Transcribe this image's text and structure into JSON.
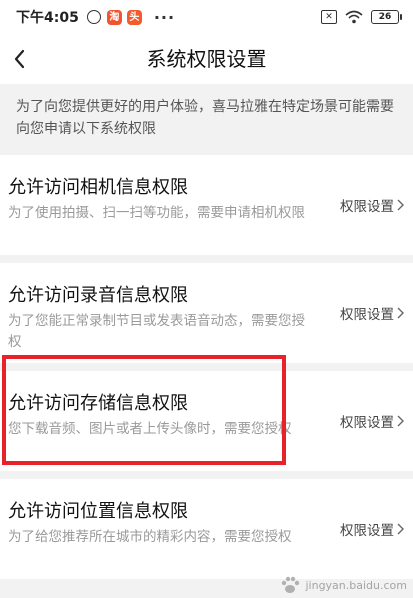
{
  "status_bar": {
    "time": "下午4:05",
    "app_icon_1": "淘",
    "app_icon_2": "头",
    "more": "···",
    "sim_icon": "✕",
    "battery": "26"
  },
  "nav": {
    "title": "系统权限设置"
  },
  "notice": "为了向您提供更好的用户体验，喜马拉雅在特定场景可能需要向您申请以下系统权限",
  "permissions": [
    {
      "title": "允许访问相机信息权限",
      "desc": "为了使用拍摄、扫一扫等功能，需要申请相机权限",
      "link": "权限设置"
    },
    {
      "title": "允许访问录音信息权限",
      "desc": "为了您能正常录制节目或发表语音动态，需要您授权",
      "link": "权限设置"
    },
    {
      "title": "允许访问存储信息权限",
      "desc": "您下载音频、图片或者上传头像时，需要您授权",
      "link": "权限设置"
    },
    {
      "title": "允许访问位置信息权限",
      "desc": "为了给您推荐所在城市的精彩内容，需要您授权",
      "link": "权限设置"
    }
  ],
  "watermark": "jingyan.baidu.com",
  "colors": {
    "highlight": "#e8212b",
    "background": "#f2f2f2",
    "card": "#ffffff",
    "desc_text": "#9a9a9a"
  }
}
